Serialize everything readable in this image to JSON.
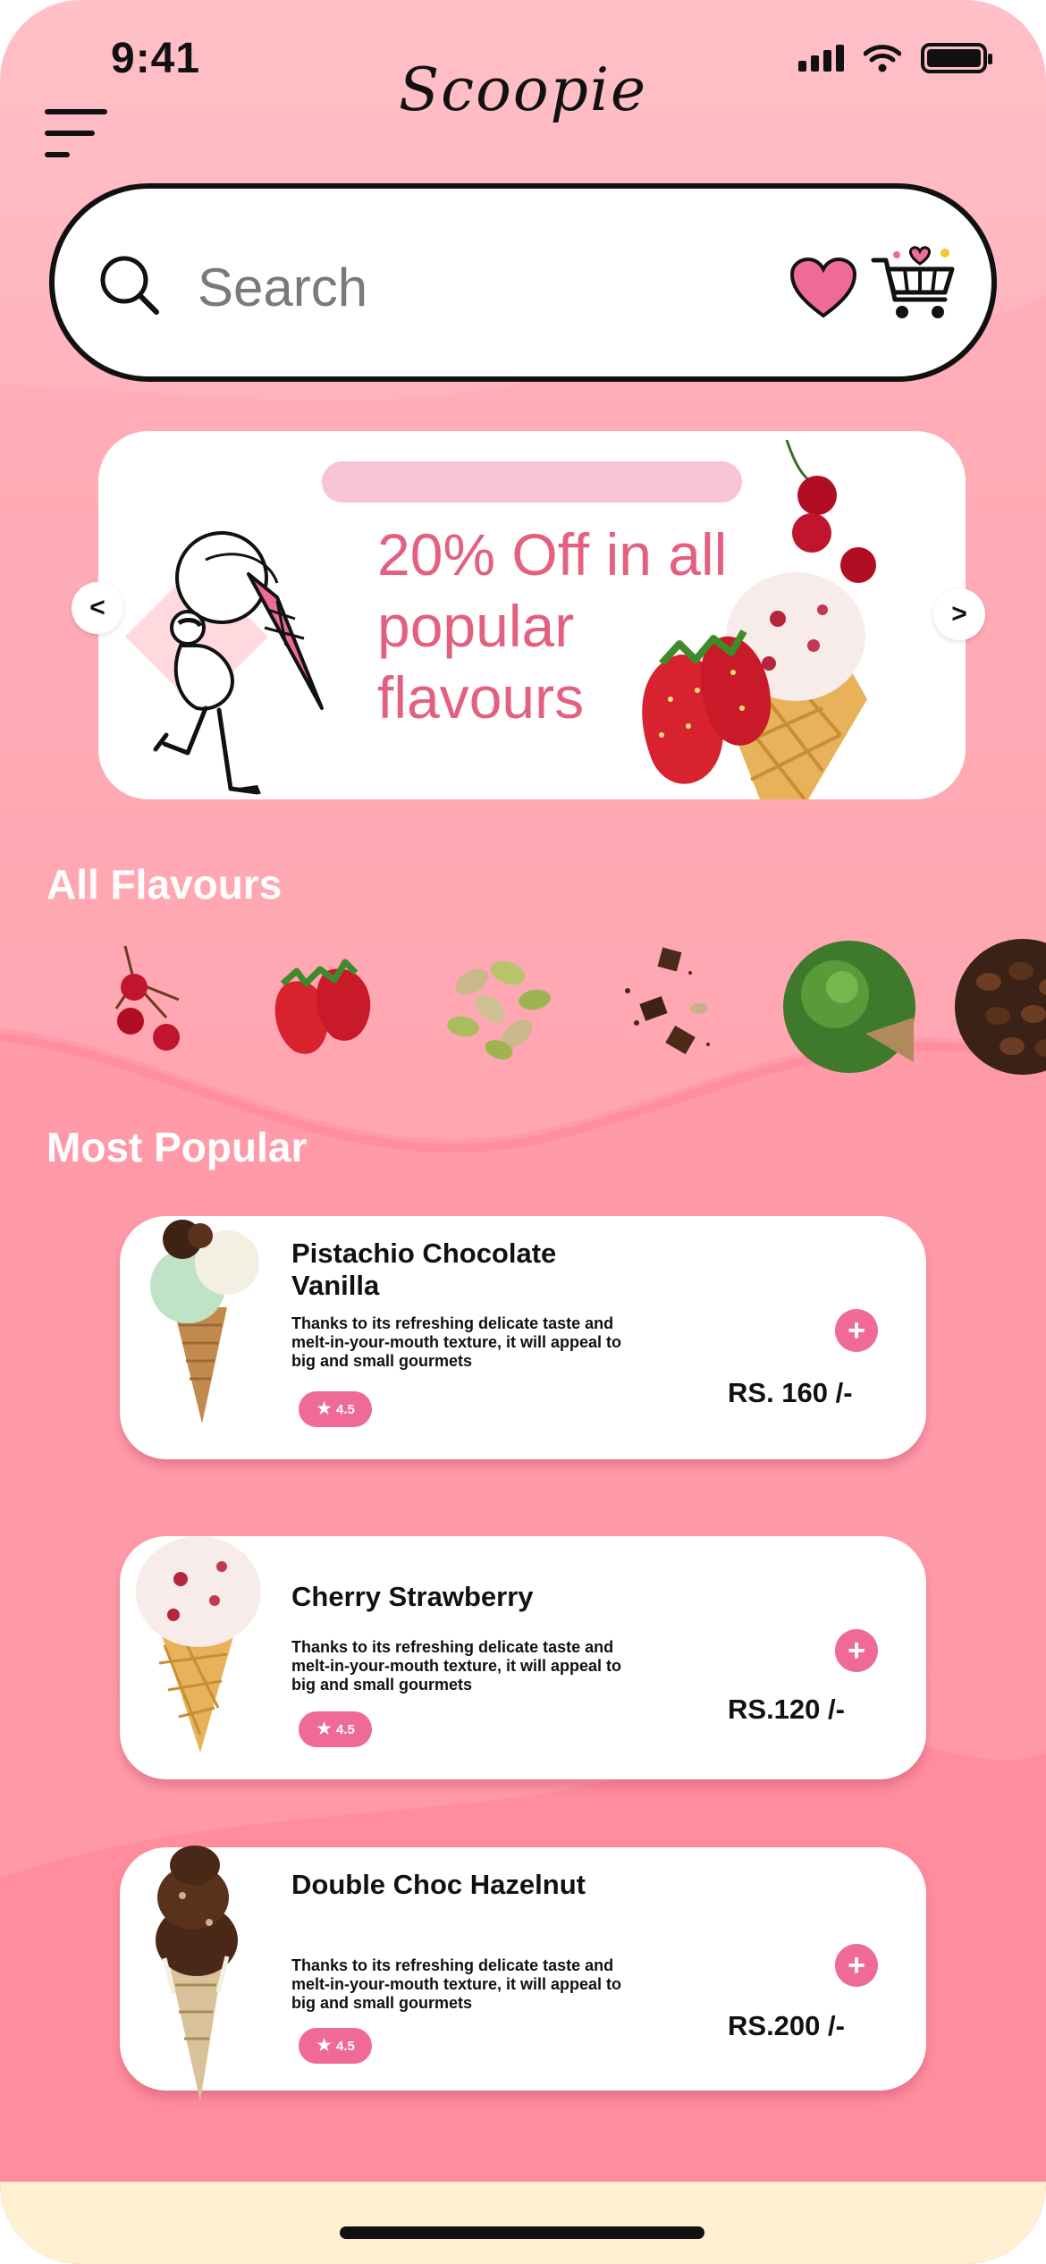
{
  "status_bar": {
    "time": "9:41"
  },
  "header": {
    "logo": "Scoopie",
    "menu_icon": "hamburger-menu-icon"
  },
  "search": {
    "placeholder": "Search",
    "favorites_icon": "heart-icon",
    "cart_icon": "cart-icon"
  },
  "promo": {
    "headline": "20% Off in all popular flavours",
    "prev_label": "<",
    "next_label": ">"
  },
  "flavours": {
    "title": "All Flavours",
    "items": [
      "cherry",
      "strawberry",
      "pistachio",
      "chocolate",
      "matcha",
      "coffee"
    ]
  },
  "popular": {
    "title": "Most Popular",
    "items": [
      {
        "name": "Pistachio Chocolate Vanilla",
        "description": "Thanks to its refreshing delicate taste and melt-in-your-mouth texture, it will appeal to big and small gourmets",
        "rating": "4.5",
        "price": "RS. 160 /-",
        "add_label": "+"
      },
      {
        "name": "Cherry Strawberry",
        "description": "Thanks to its refreshing delicate taste and melt-in-your-mouth texture, it will appeal to big and small gourmets",
        "rating": "4.5",
        "price": "RS.120 /-",
        "add_label": "+"
      },
      {
        "name": "Double Choc Hazelnut",
        "description": "Thanks to its refreshing delicate taste and melt-in-your-mouth texture, it will appeal to big and small gourmets",
        "rating": "4.5",
        "price": "RS.200 /-",
        "add_label": "+"
      }
    ]
  },
  "colors": {
    "accent": "#f06a97",
    "promo_text": "#e4607f",
    "background_top": "#ffc0c7",
    "background_bottom": "#ff7d90"
  }
}
